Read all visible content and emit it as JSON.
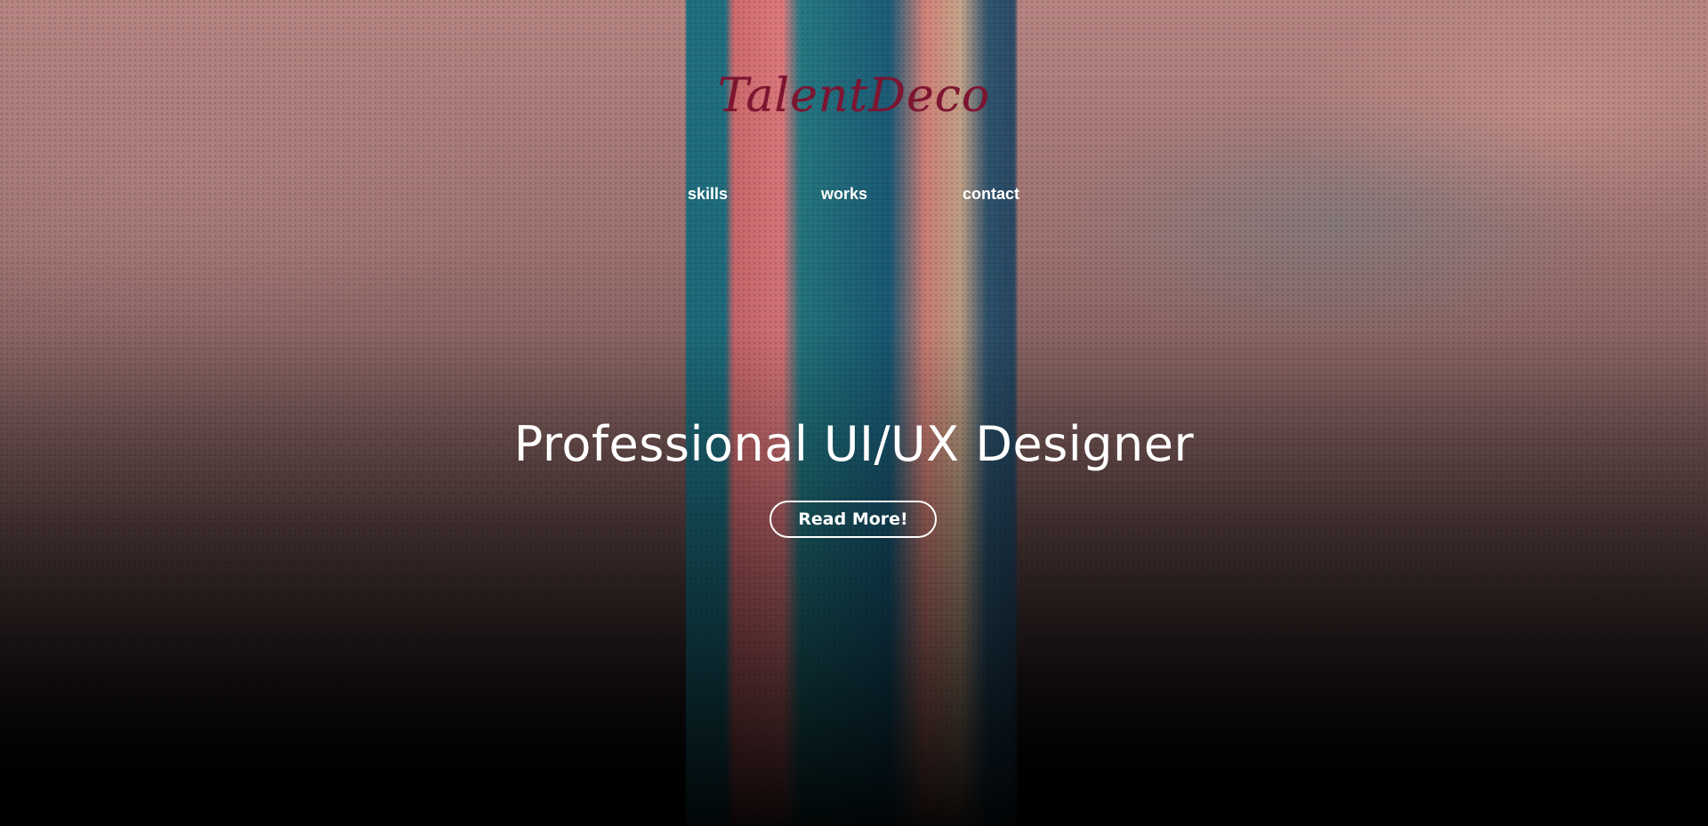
{
  "brand": {
    "logo_text": "TalentDeco",
    "logo_color": "#7d1430"
  },
  "nav": {
    "items": [
      {
        "label": "skills"
      },
      {
        "label": "works"
      },
      {
        "label": "contact"
      }
    ]
  },
  "hero": {
    "headline": "Professional UI/UX Designer",
    "cta_label": "Read More!"
  },
  "colors": {
    "text": "#ffffff",
    "background_top": "#b78582",
    "background_bottom": "#000000"
  }
}
